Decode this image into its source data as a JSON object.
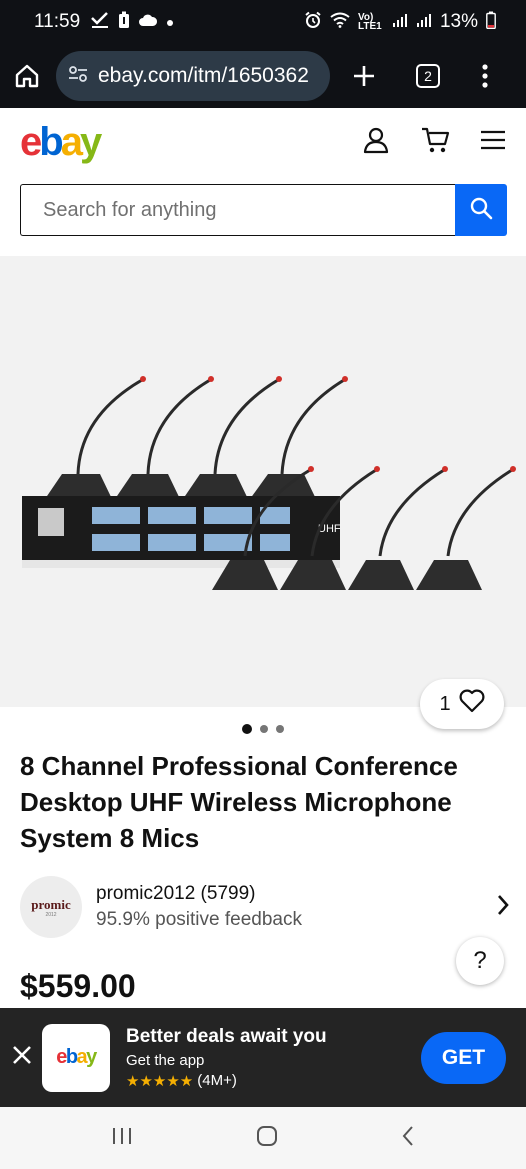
{
  "status": {
    "time": "11:59",
    "network_label": "Vo) LTE1",
    "battery": "13%"
  },
  "browser": {
    "url": "ebay.com/itm/1650362",
    "tab_count": "2"
  },
  "search": {
    "placeholder": "Search for anything"
  },
  "listing": {
    "watch_count": "1",
    "title": "8 Channel Professional Conference Desktop UHF Wireless Microphone System 8 Mics",
    "price": "$559.00",
    "image_label": "UHF"
  },
  "seller": {
    "logo_text": "promic",
    "logo_sub": "2012",
    "name": "promic2012 (5799)",
    "feedback": "95.9% positive feedback"
  },
  "app_banner": {
    "title": "Better deals await you",
    "subtitle": "Get the app",
    "rating_count": "(4M+)",
    "get_label": "GET"
  },
  "brand": {
    "logo_e": "e",
    "logo_b": "b",
    "logo_a": "a",
    "logo_y": "y",
    "colors": {
      "red": "#e53238",
      "blue": "#0064d2",
      "yellow": "#f5af02",
      "green": "#86b817",
      "accent": "#0968f6"
    }
  }
}
